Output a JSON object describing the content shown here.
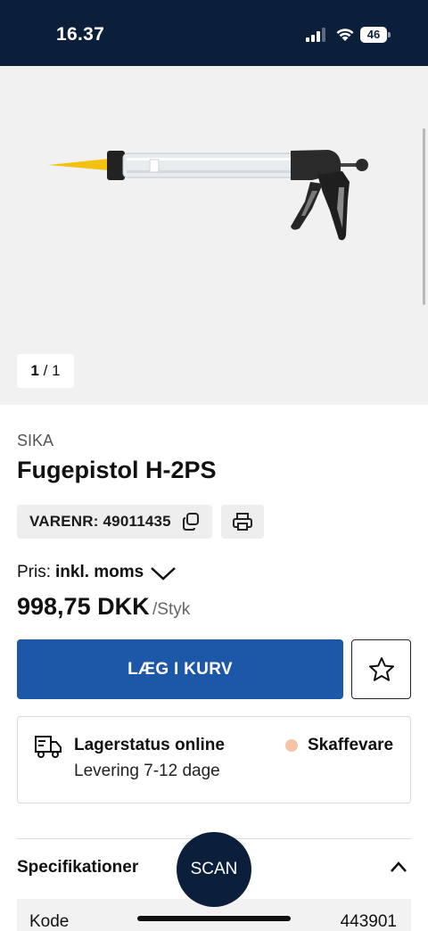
{
  "status_bar": {
    "time": "16.37",
    "battery": "46",
    "background": "#0c1f3a"
  },
  "gallery": {
    "page_current": "1",
    "page_separator": "/",
    "page_total": "1"
  },
  "product": {
    "brand": "SIKA",
    "title": "Fugepistol H-2PS",
    "sku_label": "VARENR: 49011435",
    "price_label": "Pris:",
    "price_mode": "inkl. moms",
    "price": "998,75 DKK",
    "price_unit": "/Styk"
  },
  "actions": {
    "add_to_cart": "LÆG I KURV",
    "accent": "#1d57a8"
  },
  "stock": {
    "title": "Lagerstatus online",
    "delivery": "Levering 7-12 dage",
    "status": "Skaffevare",
    "status_color": "#f4c4a4"
  },
  "specs": {
    "title": "Specifikationer",
    "rows": [
      {
        "key": "Kode",
        "value": "443901"
      }
    ]
  },
  "scan": {
    "label": "SCAN"
  },
  "icons": [
    "signal-icon",
    "wifi-icon",
    "battery-icon",
    "copy-icon",
    "print-icon",
    "chevron-down-icon",
    "star-icon",
    "truck-icon",
    "chevron-up-icon"
  ]
}
